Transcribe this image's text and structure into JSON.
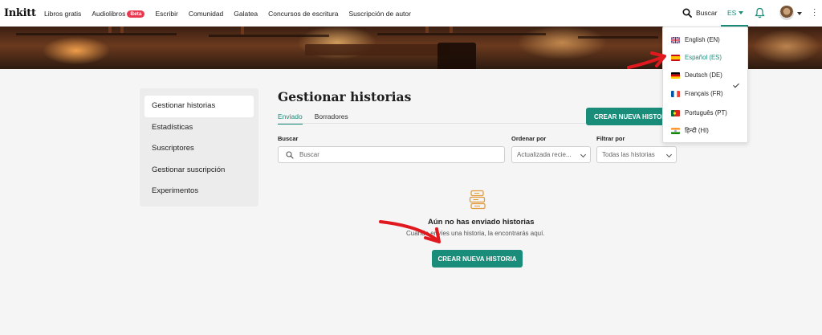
{
  "header": {
    "logo": "Inkitt",
    "nav": [
      "Libros gratis",
      "Audiolibros",
      "Escribir",
      "Comunidad",
      "Galatea",
      "Concursos de escritura",
      "Suscripción de autor"
    ],
    "beta_badge": "Beta",
    "search_label": "Buscar",
    "language_code": "ES"
  },
  "sidebar": {
    "items": [
      "Gestionar historias",
      "Estadísticas",
      "Suscriptores",
      "Gestionar suscripción",
      "Experimentos"
    ],
    "active_index": 0
  },
  "main": {
    "title": "Gestionar historias",
    "tabs": [
      "Enviado",
      "Borradores"
    ],
    "create_button_top": "CREAR NUEVA HISTORIA",
    "search_label": "Buscar",
    "search_placeholder": "Buscar",
    "sort_label": "Ordenar por",
    "sort_value": "Actualizada recie...",
    "filter_label": "Filtrar por",
    "filter_value": "Todas las historias",
    "empty_title": "Aún no has enviado historias",
    "empty_subtitle": "Cuando envíes una historia, la encontrarás aquí.",
    "create_button_center": "CREAR NUEVA HISTORIA"
  },
  "language_menu": {
    "items": [
      {
        "label": "English (EN)",
        "flag": "uk-flag"
      },
      {
        "label": "Español (ES)",
        "flag": "spain-flag",
        "selected": true
      },
      {
        "label": "Deutsch (DE)",
        "flag": "germany-flag"
      },
      {
        "label": "Français (FR)",
        "flag": "france-flag"
      },
      {
        "label": "Português (PT)",
        "flag": "portugal-flag"
      },
      {
        "label": "हिन्दी (HI)",
        "flag": "india-flag"
      }
    ]
  },
  "colors": {
    "accent": "#1a8c7a",
    "beta_badge": "#e8384f",
    "annotation_arrow": "#e0191f"
  }
}
